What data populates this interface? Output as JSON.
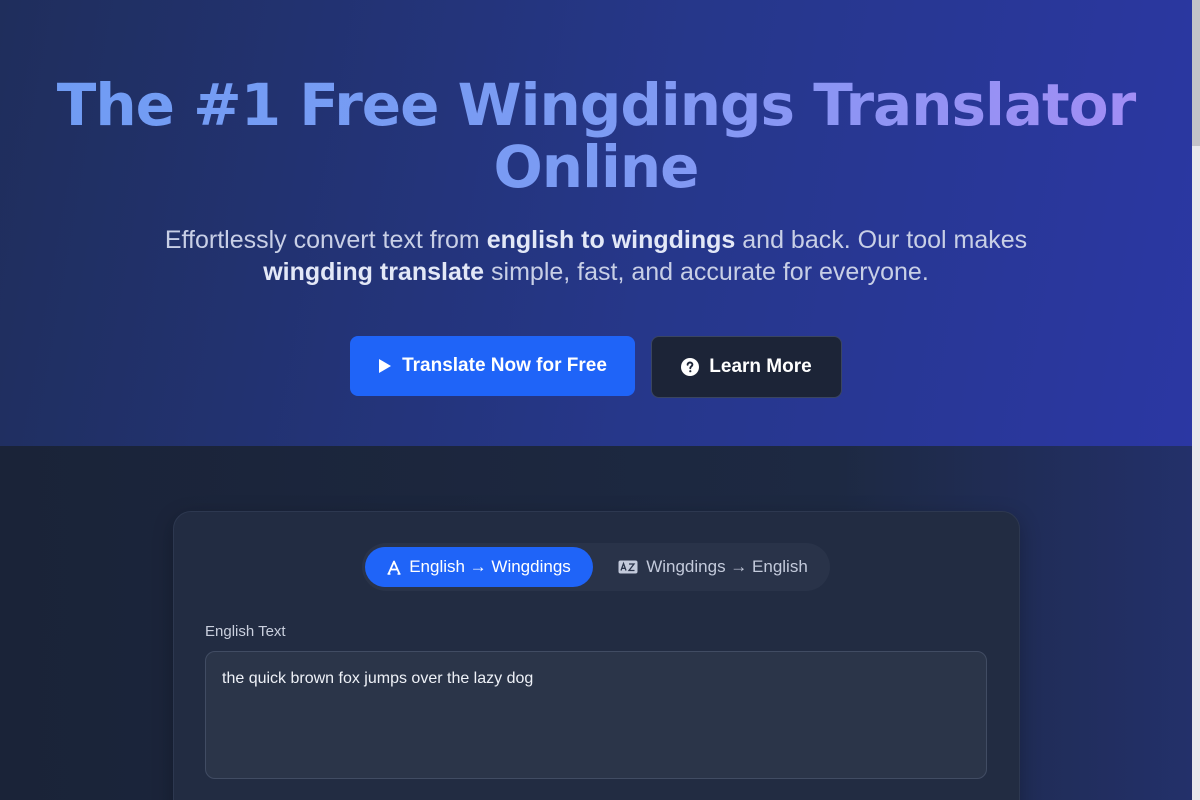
{
  "hero": {
    "title_line1": "The #1 Free Wingdings Translator",
    "title_line2": "Online",
    "subtitle": {
      "part1": "Effortlessly convert text from ",
      "bold1": "english to wingdings",
      "part2": " and back. Our tool makes ",
      "bold2": "wingding translate",
      "part3": " simple, fast, and accurate for everyone."
    },
    "primary_button": {
      "label": "Translate Now for Free",
      "icon": "play-icon"
    },
    "secondary_button": {
      "label": "Learn More",
      "icon": "question-circle-icon"
    }
  },
  "translator": {
    "tabs": [
      {
        "label": "English → Wingdings",
        "icon": "font-letter-icon",
        "active": true
      },
      {
        "label": "Wingdings → English",
        "icon": "language-icon",
        "active": false
      }
    ],
    "input": {
      "label": "English Text",
      "value": "the quick brown fox jumps over the lazy dog"
    }
  },
  "colors": {
    "accent": "#1f64f8",
    "hero_bg": "#26378a",
    "page_bg": "#1a2238"
  }
}
